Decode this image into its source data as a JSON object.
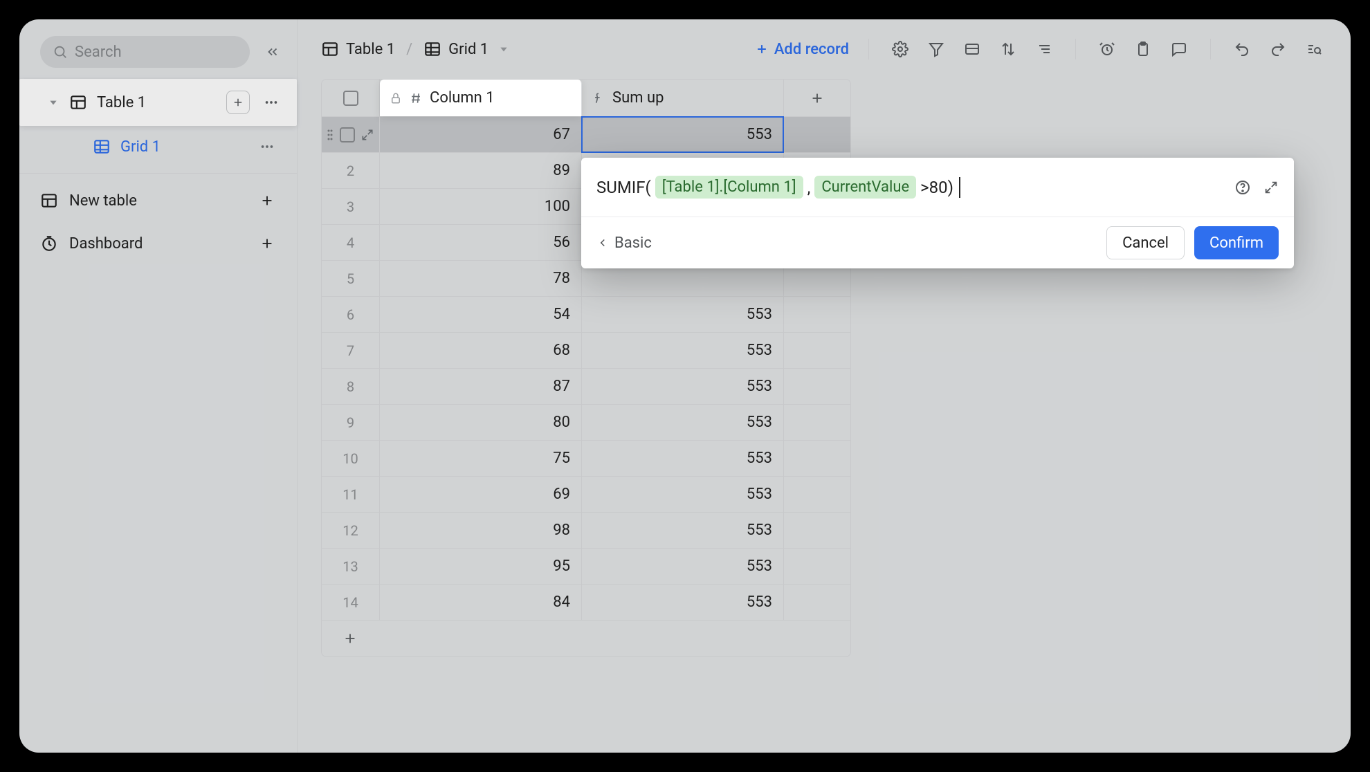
{
  "search": {
    "placeholder": "Search"
  },
  "sidebar": {
    "tables": [
      {
        "label": "Table 1"
      }
    ],
    "views": [
      {
        "label": "Grid 1"
      }
    ],
    "links": {
      "new_table": "New table",
      "dashboard": "Dashboard"
    }
  },
  "breadcrumb": {
    "table": "Table 1",
    "view": "Grid 1"
  },
  "toolbar": {
    "add_record": "Add record"
  },
  "columns": {
    "col1": "Column 1",
    "col2": "Sum up"
  },
  "rows": [
    {
      "n": "",
      "col1": "67",
      "col2": "553"
    },
    {
      "n": "2",
      "col1": "89",
      "col2": ""
    },
    {
      "n": "3",
      "col1": "100",
      "col2": ""
    },
    {
      "n": "4",
      "col1": "56",
      "col2": ""
    },
    {
      "n": "5",
      "col1": "78",
      "col2": ""
    },
    {
      "n": "6",
      "col1": "54",
      "col2": "553"
    },
    {
      "n": "7",
      "col1": "68",
      "col2": "553"
    },
    {
      "n": "8",
      "col1": "87",
      "col2": "553"
    },
    {
      "n": "9",
      "col1": "80",
      "col2": "553"
    },
    {
      "n": "10",
      "col1": "75",
      "col2": "553"
    },
    {
      "n": "11",
      "col1": "69",
      "col2": "553"
    },
    {
      "n": "12",
      "col1": "98",
      "col2": "553"
    },
    {
      "n": "13",
      "col1": "95",
      "col2": "553"
    },
    {
      "n": "14",
      "col1": "84",
      "col2": "553"
    }
  ],
  "formula": {
    "fn": "SUMIF(",
    "ref": "[Table 1].[Column 1]",
    "comma": ",",
    "curr": "CurrentValue",
    "tail": " >80)",
    "basic": "Basic",
    "cancel": "Cancel",
    "confirm": "Confirm"
  }
}
